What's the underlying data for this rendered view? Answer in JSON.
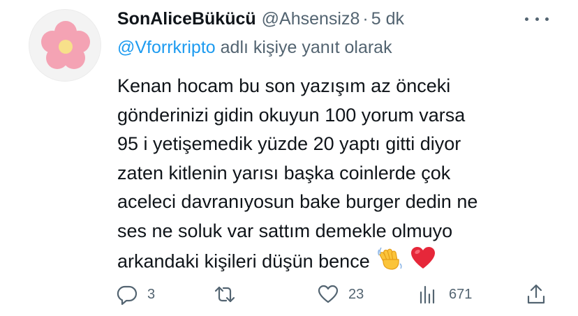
{
  "tweet": {
    "display_name": "SonAliceBükücü",
    "handle": "@Ahsensiz8",
    "separator": "·",
    "time": "5 dk",
    "reply_to": {
      "mention": "@Vforrkripto",
      "suffix": " adlı kişiye yanıt olarak"
    },
    "text_lines": [
      "Kenan hocam bu son yazışım az önceki",
      "gönderinizi gidin okuyun 100 yorum varsa",
      "95 i yetişemedik yüzde 20 yaptı gitti diyor",
      "zaten kitlenin yarısı başka coinlerde çok",
      "aceleci davranıyosun bake burger dedin ne",
      "ses ne soluk var sattım demekle olmuyo",
      "arkandaki kişileri düşün bence"
    ],
    "emojis": [
      "waving-hand-emoji",
      "red-heart-emoji"
    ]
  },
  "actions": {
    "reply_count": "3",
    "retweet_count": "",
    "like_count": "23",
    "views_count": "671"
  },
  "colors": {
    "text": "#0f1419",
    "secondary": "#536471",
    "link": "#1d9bf0",
    "avatar_flower": "#f4a3b4",
    "avatar_center": "#f7e08a"
  }
}
